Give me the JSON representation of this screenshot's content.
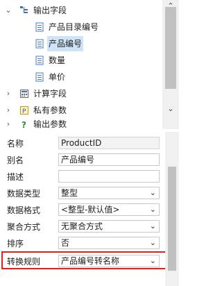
{
  "tree": {
    "root_label": "输出字段",
    "fields": [
      "产品目录编号",
      "产品编号",
      "数量",
      "单价"
    ],
    "other_nodes": [
      "计算字段",
      "私有参数",
      "输出参数"
    ]
  },
  "properties": {
    "name_label": "名称",
    "name_value": "ProductID",
    "alias_label": "别名",
    "alias_value": "产品编号",
    "desc_label": "描述",
    "desc_value": "",
    "type_label": "数据类型",
    "type_value": "整型",
    "format_label": "数据格式",
    "format_value": "<整型-默认值>",
    "agg_label": "聚合方式",
    "agg_value": "无聚合方式",
    "sort_label": "排序",
    "sort_value": "否",
    "rule_label": "转换规则",
    "rule_value": "产品编号转名称"
  }
}
